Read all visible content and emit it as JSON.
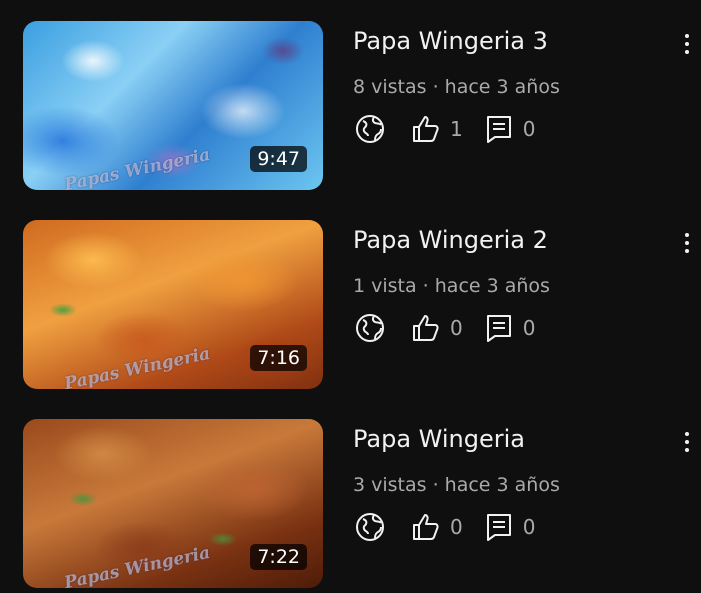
{
  "videos": [
    {
      "title": "Papa Wingeria 3",
      "meta": "8 vistas · hace 3 años",
      "duration": "9:47",
      "watermark": "Papas Wingeria",
      "likes": "1",
      "comments": "0",
      "thumb_style": "blue",
      "icons": [
        "public-globe-icon",
        "thumbs-up-icon",
        "comment-icon",
        "more-vert-icon"
      ]
    },
    {
      "title": "Papa Wingeria 2",
      "meta": "1 vista · hace 3 años",
      "duration": "7:16",
      "watermark": "Papas Wingeria",
      "likes": "0",
      "comments": "0",
      "thumb_style": "wing1",
      "icons": [
        "public-globe-icon",
        "thumbs-up-icon",
        "comment-icon",
        "more-vert-icon"
      ]
    },
    {
      "title": "Papa Wingeria",
      "meta": "3 vistas · hace 3 años",
      "duration": "7:22",
      "watermark": "Papas Wingeria",
      "likes": "0",
      "comments": "0",
      "thumb_style": "wing2",
      "icons": [
        "public-globe-icon",
        "thumbs-up-icon",
        "comment-icon",
        "more-vert-icon"
      ]
    }
  ],
  "colors": {
    "background": "#0f0f0f",
    "title_text": "#f1f1f1",
    "secondary_text": "#aaaaaa",
    "duration_badge": "#000000"
  }
}
